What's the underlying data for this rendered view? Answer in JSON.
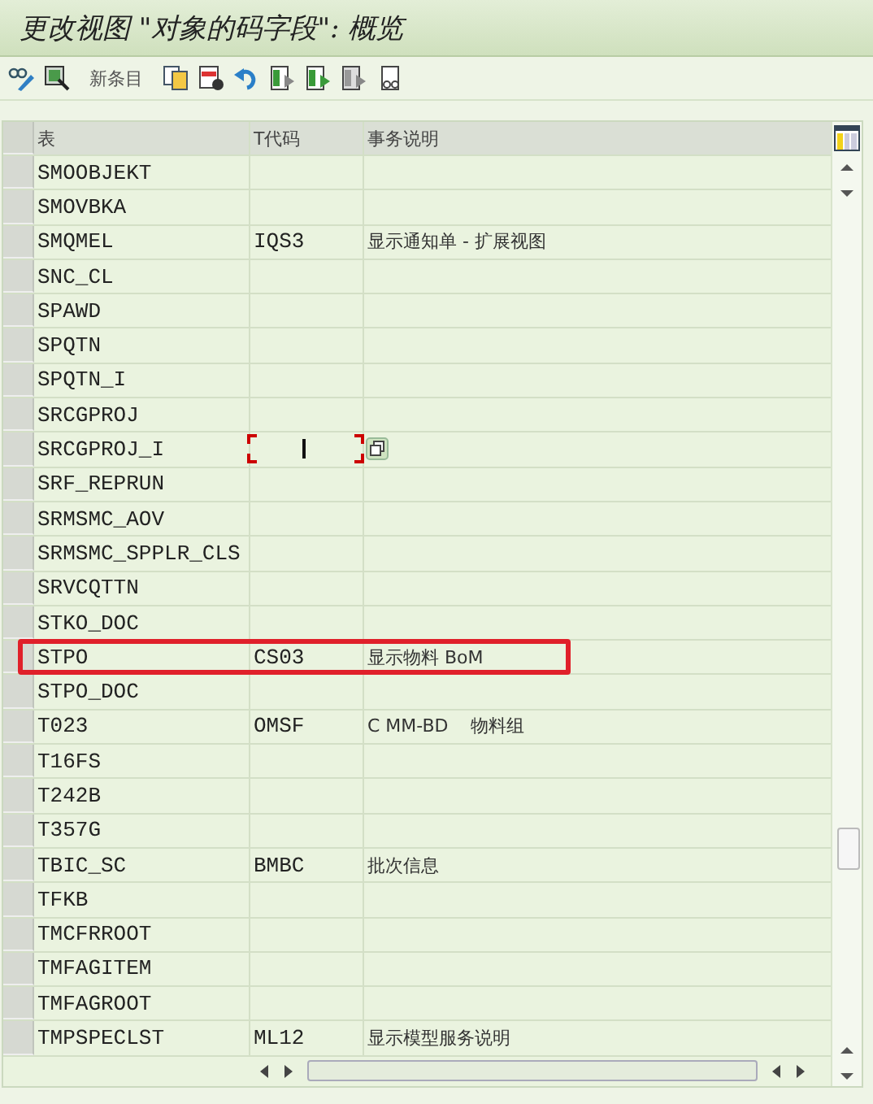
{
  "window": {
    "title": "更改视图 \"对象的码字段\": 概览"
  },
  "toolbar": {
    "buttons": [
      {
        "kind": "display-change"
      },
      {
        "kind": "select"
      },
      {
        "kind": "text",
        "label": "新条目"
      },
      {
        "kind": "copy"
      },
      {
        "kind": "delete"
      },
      {
        "kind": "undo"
      },
      {
        "kind": "select-all"
      },
      {
        "kind": "select-block"
      },
      {
        "kind": "deselect"
      },
      {
        "kind": "print"
      }
    ]
  },
  "table": {
    "columns": [
      "表",
      "T代码",
      "事务说明"
    ],
    "rows": [
      {
        "table": "SMOOBJEKT",
        "tcode": "",
        "description": "",
        "focused": false,
        "highlighted": false
      },
      {
        "table": "SMOVBKA",
        "tcode": "",
        "description": "",
        "focused": false,
        "highlighted": false
      },
      {
        "table": "SMQMEL",
        "tcode": "IQS3",
        "description": "显示通知单 - 扩展视图",
        "focused": false,
        "highlighted": false
      },
      {
        "table": "SNC_CL",
        "tcode": "",
        "description": "",
        "focused": false,
        "highlighted": false
      },
      {
        "table": "SPAWD",
        "tcode": "",
        "description": "",
        "focused": false,
        "highlighted": false
      },
      {
        "table": "SPQTN",
        "tcode": "",
        "description": "",
        "focused": false,
        "highlighted": false
      },
      {
        "table": "SPQTN_I",
        "tcode": "",
        "description": "",
        "focused": false,
        "highlighted": false
      },
      {
        "table": "SRCGPROJ",
        "tcode": "",
        "description": "",
        "focused": false,
        "highlighted": false
      },
      {
        "table": "SRCGPROJ_I",
        "tcode": "",
        "description": "",
        "focused": true,
        "highlighted": false
      },
      {
        "table": "SRF_REPRUN",
        "tcode": "",
        "description": "",
        "focused": false,
        "highlighted": false
      },
      {
        "table": "SRMSMC_AOV",
        "tcode": "",
        "description": "",
        "focused": false,
        "highlighted": false
      },
      {
        "table": "SRMSMC_SPPLR_CLS",
        "tcode": "",
        "description": "",
        "focused": false,
        "highlighted": false
      },
      {
        "table": "SRVCQTTN",
        "tcode": "",
        "description": "",
        "focused": false,
        "highlighted": false
      },
      {
        "table": "STKO_DOC",
        "tcode": "",
        "description": "",
        "focused": false,
        "highlighted": false
      },
      {
        "table": "STPO",
        "tcode": "CS03",
        "description": "显示物料 BoM",
        "focused": false,
        "highlighted": true
      },
      {
        "table": "STPO_DOC",
        "tcode": "",
        "description": "",
        "focused": false,
        "highlighted": false
      },
      {
        "table": "T023",
        "tcode": "OMSF",
        "description": "C MM-BD    物料组",
        "focused": false,
        "highlighted": false
      },
      {
        "table": "T16FS",
        "tcode": "",
        "description": "",
        "focused": false,
        "highlighted": false
      },
      {
        "table": "T242B",
        "tcode": "",
        "description": "",
        "focused": false,
        "highlighted": false
      },
      {
        "table": "T357G",
        "tcode": "",
        "description": "",
        "focused": false,
        "highlighted": false
      },
      {
        "table": "TBIC_SC",
        "tcode": "BMBC",
        "description": "批次信息",
        "focused": false,
        "highlighted": false
      },
      {
        "table": "TFKB",
        "tcode": "",
        "description": "",
        "focused": false,
        "highlighted": false
      },
      {
        "table": "TMCFRROOT",
        "tcode": "",
        "description": "",
        "focused": false,
        "highlighted": false
      },
      {
        "table": "TMFAGITEM",
        "tcode": "",
        "description": "",
        "focused": false,
        "highlighted": false
      },
      {
        "table": "TMFAGROOT",
        "tcode": "",
        "description": "",
        "focused": false,
        "highlighted": false
      },
      {
        "table": "TMPSPECLST",
        "tcode": "ML12",
        "description": "显示模型服务说明",
        "focused": false,
        "highlighted": false
      }
    ]
  }
}
